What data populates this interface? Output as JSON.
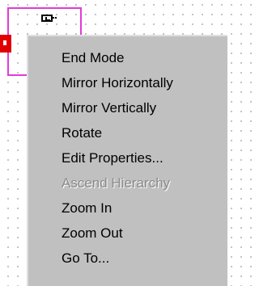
{
  "context_menu": {
    "items": [
      {
        "label": "End Mode",
        "enabled": true
      },
      {
        "label": "Mirror Horizontally",
        "enabled": true
      },
      {
        "label": "Mirror Vertically",
        "enabled": true
      },
      {
        "label": "Rotate",
        "enabled": true
      },
      {
        "label": "Edit Properties...",
        "enabled": true
      },
      {
        "label": "Ascend Hierarchy",
        "enabled": false
      },
      {
        "label": "Zoom In",
        "enabled": true
      },
      {
        "label": "Zoom Out",
        "enabled": true
      },
      {
        "label": "Go To...",
        "enabled": true
      }
    ]
  },
  "colors": {
    "selection_box": "#e23ad6",
    "marker": "#e00000",
    "menu_background": "#c0c0c0",
    "disabled_text": "#8a8a8a"
  },
  "icons": {
    "port_symbol": "port-symbol-icon",
    "marker": "red-marker-icon"
  }
}
